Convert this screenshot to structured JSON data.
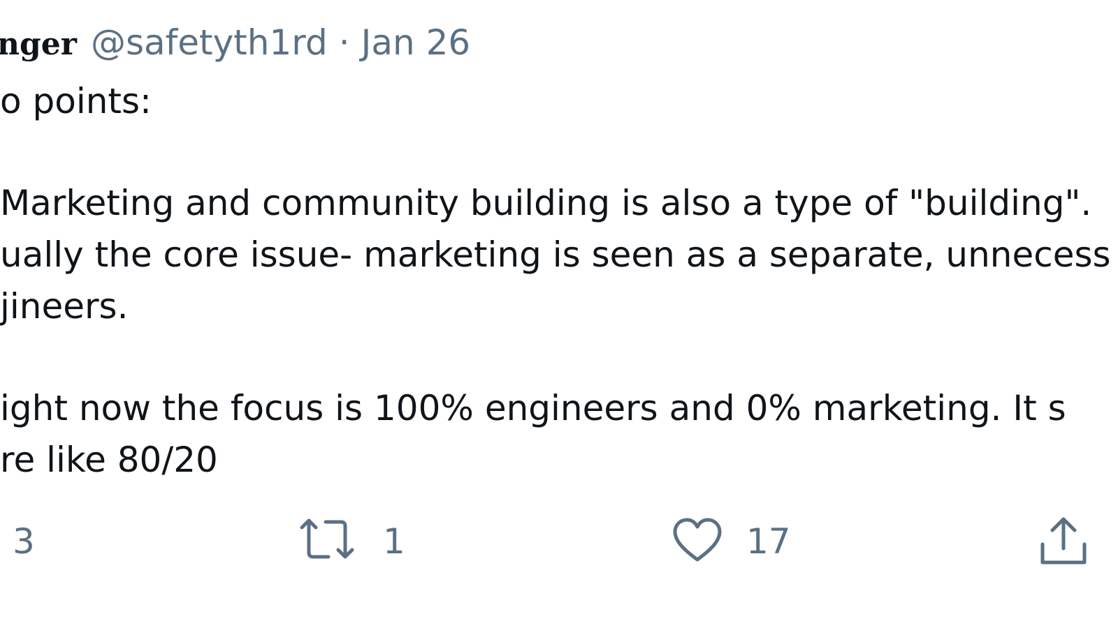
{
  "tweet": {
    "display_name": "nger",
    "handle": "@safetyth1rd",
    "separator": "·",
    "date": "Jan 26",
    "lines": [
      "o points:",
      "Marketing and community building is also a type of \"building\".",
      "ually the core issue- marketing is seen as a separate, unnecess",
      "jineers.",
      "ight now the focus is 100%  engineers and 0%  marketing. It s",
      "re like 80/20"
    ]
  },
  "actions": {
    "reply_count": "3",
    "retweet_count": "1",
    "like_count": "17",
    "icons": {
      "retweet": "retweet-icon",
      "like": "heart-icon",
      "share": "share-icon"
    },
    "icon_color": "#5b7083"
  },
  "colors": {
    "text": "#0f1419",
    "secondary": "#5b7083",
    "background": "#ffffff"
  }
}
